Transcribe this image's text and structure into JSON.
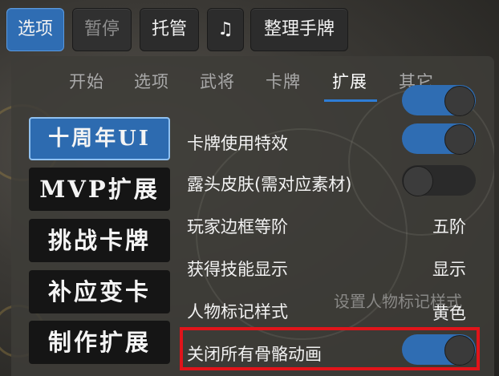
{
  "toolbar": {
    "options_label": "选项",
    "pause_label": "暂停",
    "autoplay_label": "托管",
    "music_icon": "♫",
    "sort_label": "整理手牌"
  },
  "tabs": [
    {
      "label": "开始"
    },
    {
      "label": "选项"
    },
    {
      "label": "武将"
    },
    {
      "label": "卡牌"
    },
    {
      "label": "扩展",
      "active": true
    },
    {
      "label": "其它"
    }
  ],
  "categories": [
    {
      "label": "十周年UI",
      "active": true
    },
    {
      "label": "MVP扩展"
    },
    {
      "label": "挑战卡牌"
    },
    {
      "label": "补应变卡"
    },
    {
      "label": "制作扩展"
    }
  ],
  "settings": {
    "card_effect_label": "卡牌使用特效",
    "skin_label": "露头皮肤(需对应素材)",
    "border_label": "玩家边框等阶",
    "border_value": "五阶",
    "skill_label": "获得技能显示",
    "skill_value": "显示",
    "marker_label": "人物标记样式",
    "marker_value": "黄色",
    "marker_hint": "设置人物标记样式",
    "skeleton_label": "关闭所有骨骼动画"
  },
  "colors": {
    "accent": "#2f6db3",
    "highlight": "#e0141a"
  }
}
